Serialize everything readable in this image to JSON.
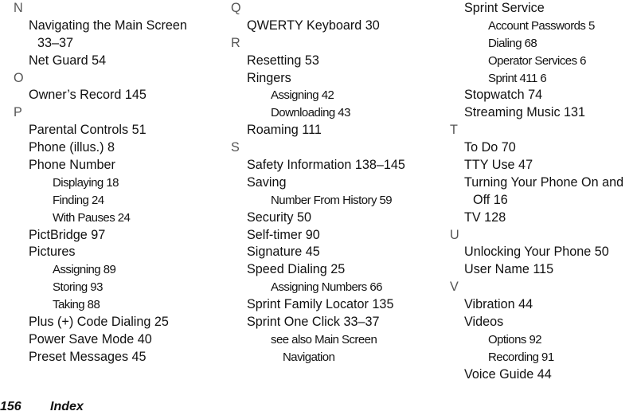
{
  "columns": [
    {
      "rows": [
        {
          "type": "letter",
          "text": "N"
        },
        {
          "type": "entry",
          "text": "Navigating the Main Screen"
        },
        {
          "type": "entry-cont",
          "text": "33–37"
        },
        {
          "type": "entry",
          "text": "Net Guard 54"
        },
        {
          "type": "letter",
          "text": "O"
        },
        {
          "type": "entry",
          "text": "Owner’s Record 145"
        },
        {
          "type": "letter",
          "text": "P"
        },
        {
          "type": "entry",
          "text": "Parental Controls 51"
        },
        {
          "type": "entry",
          "text": "Phone (illus.) 8"
        },
        {
          "type": "entry",
          "text": "Phone Number"
        },
        {
          "type": "sub",
          "text": "Displaying 18"
        },
        {
          "type": "sub",
          "text": "Finding 24"
        },
        {
          "type": "sub",
          "text": "With Pauses 24"
        },
        {
          "type": "entry",
          "text": "PictBridge 97"
        },
        {
          "type": "entry",
          "text": "Pictures"
        },
        {
          "type": "sub",
          "text": "Assigning 89"
        },
        {
          "type": "sub",
          "text": "Storing 93"
        },
        {
          "type": "sub",
          "text": "Taking 88"
        },
        {
          "type": "entry",
          "text": "Plus (+) Code Dialing 25"
        },
        {
          "type": "entry",
          "text": "Power Save Mode 40"
        },
        {
          "type": "entry",
          "text": "Preset Messages 45"
        }
      ]
    },
    {
      "rows": [
        {
          "type": "letter",
          "text": "Q"
        },
        {
          "type": "entry",
          "text": "QWERTY Keyboard 30"
        },
        {
          "type": "letter",
          "text": "R"
        },
        {
          "type": "entry",
          "text": "Resetting 53"
        },
        {
          "type": "entry",
          "text": "Ringers"
        },
        {
          "type": "sub",
          "text": "Assigning 42"
        },
        {
          "type": "sub",
          "text": "Downloading 43"
        },
        {
          "type": "entry",
          "text": "Roaming 111"
        },
        {
          "type": "letter",
          "text": "S"
        },
        {
          "type": "entry",
          "text": "Safety Information 138–145"
        },
        {
          "type": "entry",
          "text": "Saving"
        },
        {
          "type": "sub",
          "text": "Number From History 59"
        },
        {
          "type": "entry",
          "text": "Security 50"
        },
        {
          "type": "entry",
          "text": "Self-timer 90"
        },
        {
          "type": "entry",
          "text": "Signature 45"
        },
        {
          "type": "entry",
          "text": "Speed Dialing 25"
        },
        {
          "type": "sub",
          "text": "Assigning Numbers 66"
        },
        {
          "type": "entry",
          "text": "Sprint Family Locator 135"
        },
        {
          "type": "entry",
          "text": "Sprint One Click 33–37"
        },
        {
          "type": "sub",
          "text": "see also Main Screen"
        },
        {
          "type": "sub-cont",
          "text": "Navigation"
        }
      ]
    },
    {
      "rows": [
        {
          "type": "entry",
          "text": "Sprint Service"
        },
        {
          "type": "sub",
          "text": "Account Passwords 5"
        },
        {
          "type": "sub",
          "text": "Dialing 68"
        },
        {
          "type": "sub",
          "text": "Operator Services 6"
        },
        {
          "type": "sub",
          "text": "Sprint 411 6"
        },
        {
          "type": "entry",
          "text": "Stopwatch 74"
        },
        {
          "type": "entry",
          "text": "Streaming Music 131"
        },
        {
          "type": "letter",
          "text": "T"
        },
        {
          "type": "entry",
          "text": "To Do 70"
        },
        {
          "type": "entry",
          "text": "TTY Use 47"
        },
        {
          "type": "entry",
          "text": "Turning Your Phone On and"
        },
        {
          "type": "entry-cont",
          "text": "Off 16"
        },
        {
          "type": "entry",
          "text": "TV 128"
        },
        {
          "type": "letter",
          "text": "U"
        },
        {
          "type": "entry",
          "text": "Unlocking Your Phone 50"
        },
        {
          "type": "entry",
          "text": "User Name 115"
        },
        {
          "type": "letter",
          "text": "V"
        },
        {
          "type": "entry",
          "text": "Vibration 44"
        },
        {
          "type": "entry",
          "text": "Videos"
        },
        {
          "type": "sub",
          "text": "Options 92"
        },
        {
          "type": "sub",
          "text": "Recording 91"
        },
        {
          "type": "entry",
          "text": "Voice Guide 44"
        }
      ]
    }
  ],
  "footer": {
    "page_number": "156",
    "section_title": "Index"
  }
}
